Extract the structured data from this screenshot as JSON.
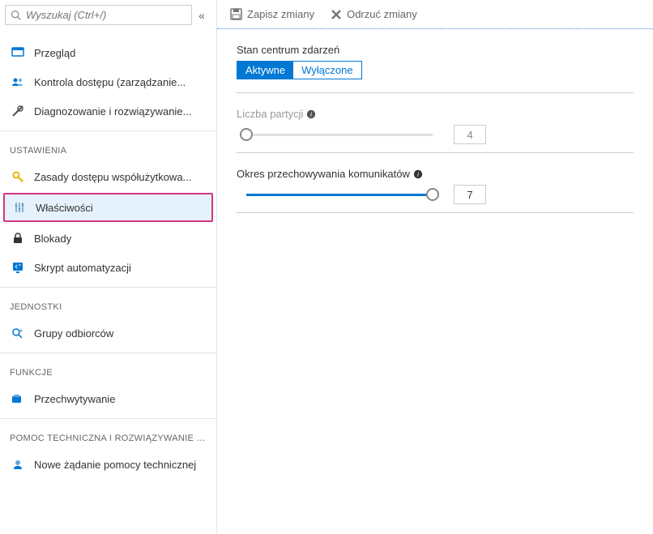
{
  "search": {
    "placeholder": "Wyszukaj (Ctrl+/)"
  },
  "sidebar": {
    "items": [
      {
        "label": "Przegląd"
      },
      {
        "label": "Kontrola dostępu (zarządzanie..."
      },
      {
        "label": "Diagnozowanie i rozwiązywanie..."
      }
    ],
    "sections": [
      {
        "header": "USTAWIENIA",
        "items": [
          {
            "label": "Zasady dostępu współużytkowa..."
          },
          {
            "label": "Właściwości"
          },
          {
            "label": "Blokady"
          },
          {
            "label": "Skrypt automatyzacji"
          }
        ]
      },
      {
        "header": "JEDNOSTKI",
        "items": [
          {
            "label": "Grupy odbiorców"
          }
        ]
      },
      {
        "header": "FUNKCJE",
        "items": [
          {
            "label": "Przechwytywanie"
          }
        ]
      },
      {
        "header": "POMOC TECHNICZNA I ROZWIĄZYWANIE P...",
        "items": [
          {
            "label": "Nowe żądanie pomocy technicznej"
          }
        ]
      }
    ]
  },
  "toolbar": {
    "save": "Zapisz zmiany",
    "discard": "Odrzuć zmiany"
  },
  "form": {
    "state_label": "Stan centrum zdarzeń",
    "state_options": {
      "active": "Aktywne",
      "disabled": "Wyłączone"
    },
    "partitions_label": "Liczba partycji",
    "partitions_value": "4",
    "retention_label": "Okres przechowywania komunikatów",
    "retention_value": "7"
  }
}
